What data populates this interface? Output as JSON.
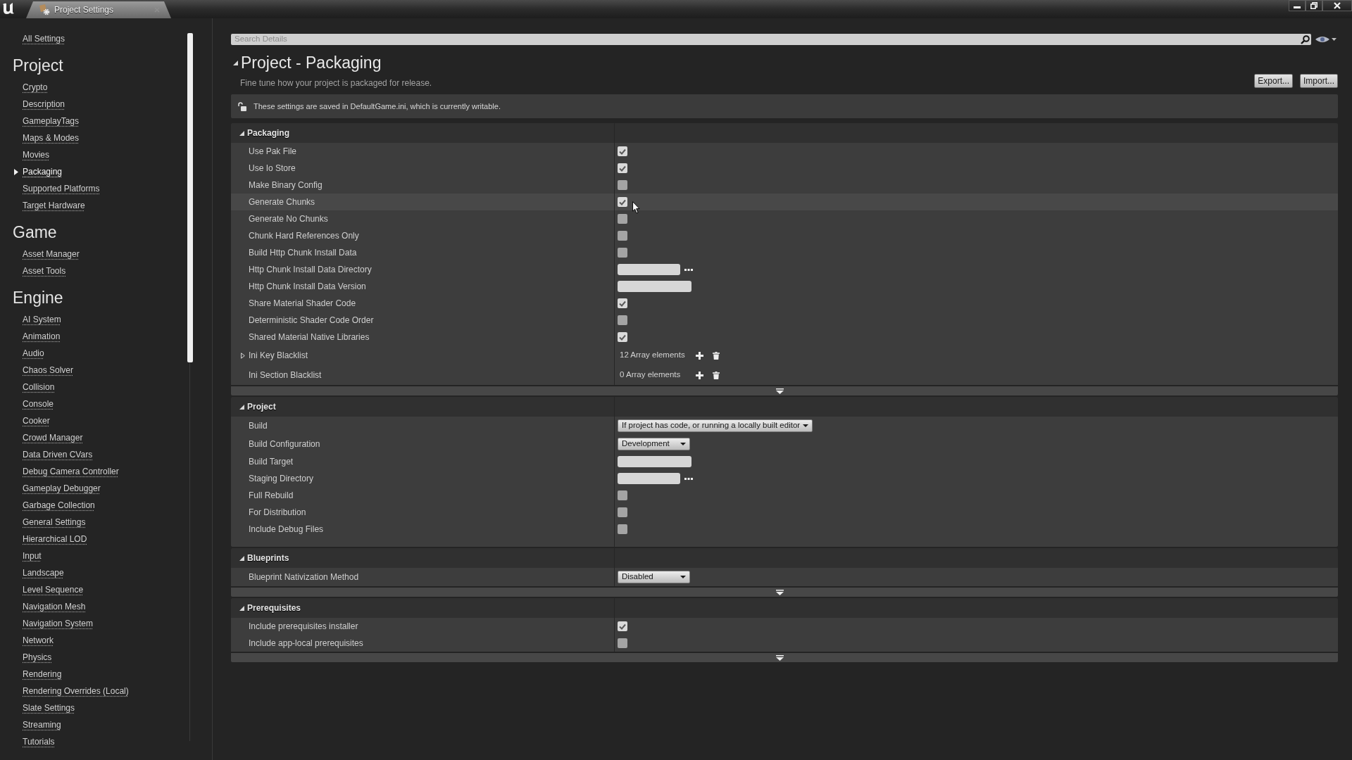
{
  "window": {
    "tab_title": "Project Settings"
  },
  "sidebar": {
    "all_settings": {
      "label": "All Settings",
      "selected": false
    },
    "groups": [
      {
        "title": "Project",
        "items": [
          {
            "label": "Crypto",
            "selected": false
          },
          {
            "label": "Description",
            "selected": false
          },
          {
            "label": "GameplayTags",
            "selected": false
          },
          {
            "label": "Maps & Modes",
            "selected": false
          },
          {
            "label": "Movies",
            "selected": false
          },
          {
            "label": "Packaging",
            "selected": true
          },
          {
            "label": "Supported Platforms",
            "selected": false
          },
          {
            "label": "Target Hardware",
            "selected": false
          }
        ]
      },
      {
        "title": "Game",
        "items": [
          {
            "label": "Asset Manager",
            "selected": false
          },
          {
            "label": "Asset Tools",
            "selected": false
          }
        ]
      },
      {
        "title": "Engine",
        "items": [
          {
            "label": "AI System",
            "selected": false
          },
          {
            "label": "Animation",
            "selected": false
          },
          {
            "label": "Audio",
            "selected": false
          },
          {
            "label": "Chaos Solver",
            "selected": false
          },
          {
            "label": "Collision",
            "selected": false
          },
          {
            "label": "Console",
            "selected": false
          },
          {
            "label": "Cooker",
            "selected": false
          },
          {
            "label": "Crowd Manager",
            "selected": false
          },
          {
            "label": "Data Driven CVars",
            "selected": false
          },
          {
            "label": "Debug Camera Controller",
            "selected": false
          },
          {
            "label": "Gameplay Debugger",
            "selected": false
          },
          {
            "label": "Garbage Collection",
            "selected": false
          },
          {
            "label": "General Settings",
            "selected": false
          },
          {
            "label": "Hierarchical LOD",
            "selected": false
          },
          {
            "label": "Input",
            "selected": false
          },
          {
            "label": "Landscape",
            "selected": false
          },
          {
            "label": "Level Sequence",
            "selected": false
          },
          {
            "label": "Navigation Mesh",
            "selected": false
          },
          {
            "label": "Navigation System",
            "selected": false
          },
          {
            "label": "Network",
            "selected": false
          },
          {
            "label": "Physics",
            "selected": false
          },
          {
            "label": "Rendering",
            "selected": false
          },
          {
            "label": "Rendering Overrides (Local)",
            "selected": false
          },
          {
            "label": "Slate Settings",
            "selected": false
          },
          {
            "label": "Streaming",
            "selected": false
          },
          {
            "label": "Tutorials",
            "selected": false
          }
        ]
      }
    ]
  },
  "search": {
    "placeholder": "Search Details"
  },
  "details": {
    "title": "Project - Packaging",
    "expanded": true,
    "description": "Fine tune how your project is packaged for release.",
    "buttons": [
      "Export...",
      "Import..."
    ],
    "notice": "These settings are saved in DefaultGame.ini, which is currently writable.",
    "sections": [
      {
        "title": "Packaging",
        "expanded": true,
        "advanced_toggle": true,
        "rows": [
          {
            "label": "Use Pak File",
            "kind": "checkbox",
            "checked": true,
            "hovered": false
          },
          {
            "label": "Use Io Store",
            "kind": "checkbox",
            "checked": true,
            "hovered": false
          },
          {
            "label": "Make Binary Config",
            "kind": "checkbox",
            "checked": false,
            "hovered": false
          },
          {
            "label": "Generate Chunks",
            "kind": "checkbox",
            "checked": true,
            "hovered": true
          },
          {
            "label": "Generate No Chunks",
            "kind": "checkbox",
            "checked": false,
            "hovered": false
          },
          {
            "label": "Chunk Hard References Only",
            "kind": "checkbox",
            "checked": false,
            "hovered": false
          },
          {
            "label": "Build Http Chunk Install Data",
            "kind": "checkbox",
            "checked": false,
            "hovered": false
          },
          {
            "label": "Http Chunk Install Data Directory",
            "kind": "text",
            "browse": true,
            "hovered": false
          },
          {
            "label": "Http Chunk Install Data Version",
            "kind": "text",
            "browse": false,
            "hovered": false
          },
          {
            "label": "Share Material Shader Code",
            "kind": "checkbox",
            "checked": true,
            "hovered": false
          },
          {
            "label": "Deterministic Shader Code Order",
            "kind": "checkbox",
            "checked": false,
            "hovered": false
          },
          {
            "label": "Shared Material Native Libraries",
            "kind": "checkbox",
            "checked": true,
            "hovered": false
          },
          {
            "label": "Ini Key Blacklist",
            "kind": "array",
            "value": "12 Array elements",
            "expandable": true,
            "hovered": false
          },
          {
            "label": "Ini Section Blacklist",
            "kind": "array",
            "value": "0 Array elements",
            "expandable": false,
            "hovered": false
          }
        ]
      },
      {
        "title": "Project",
        "expanded": true,
        "advanced_toggle": false,
        "rows": [
          {
            "label": "Build",
            "kind": "dropdown",
            "value": "If project has code, or running a locally built editor",
            "hovered": false
          },
          {
            "label": "Build Configuration",
            "kind": "dropdown",
            "value": "Development",
            "hovered": false
          },
          {
            "label": "Build Target",
            "kind": "text",
            "browse": false,
            "hovered": false
          },
          {
            "label": "Staging Directory",
            "kind": "text",
            "browse": true,
            "hovered": false
          },
          {
            "label": "Full Rebuild",
            "kind": "checkbox",
            "checked": false,
            "hovered": false
          },
          {
            "label": "For Distribution",
            "kind": "checkbox",
            "checked": false,
            "hovered": false
          },
          {
            "label": "Include Debug Files",
            "kind": "checkbox",
            "checked": false,
            "hovered": false
          }
        ]
      },
      {
        "title": "Blueprints",
        "expanded": true,
        "advanced_toggle": true,
        "rows": [
          {
            "label": "Blueprint Nativization Method",
            "kind": "dropdown",
            "value": "Disabled",
            "hovered": false
          }
        ]
      },
      {
        "title": "Prerequisites",
        "expanded": true,
        "advanced_toggle": true,
        "rows": [
          {
            "label": "Include prerequisites installer",
            "kind": "checkbox",
            "checked": true,
            "hovered": false
          },
          {
            "label": "Include app-local prerequisites",
            "kind": "checkbox",
            "checked": false,
            "hovered": false
          }
        ]
      }
    ]
  }
}
